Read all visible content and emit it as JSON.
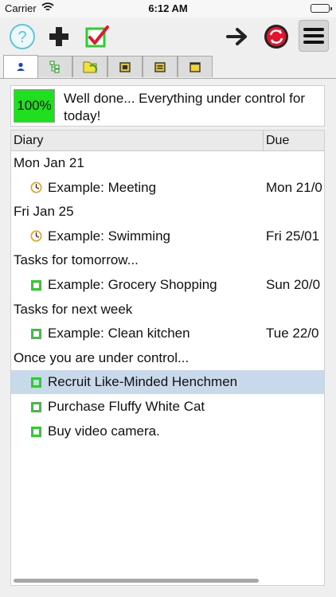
{
  "status_bar": {
    "carrier": "Carrier",
    "time": "6:12 AM"
  },
  "toolbar": {
    "help_icon": "question-circle-icon",
    "add_icon": "plus-icon",
    "complete_icon": "red-checkmark-icon",
    "forward_icon": "arrow-right-icon",
    "sync_icon": "red-sync-icon",
    "menu_icon": "hamburger-menu-icon"
  },
  "tabs": [
    {
      "icon": "person-icon",
      "active": true
    },
    {
      "icon": "hierarchy-icon",
      "active": false
    },
    {
      "icon": "folder-icon",
      "active": false
    },
    {
      "icon": "calendar-icon",
      "active": false
    },
    {
      "icon": "calendar-icon",
      "active": false
    },
    {
      "icon": "notepad-icon",
      "active": false
    }
  ],
  "banner": {
    "percent": "100%",
    "message": "Well done... Everything under control for today!",
    "percent_color": "#1fe01f"
  },
  "table": {
    "headers": {
      "diary": "Diary",
      "due": "Due"
    },
    "rows": [
      {
        "type": "group",
        "label": "Mon Jan 21"
      },
      {
        "type": "task",
        "icon": "clock-icon",
        "label": "Example: Meeting",
        "due": "Mon 21/0"
      },
      {
        "type": "group",
        "label": "Fri Jan 25"
      },
      {
        "type": "task",
        "icon": "clock-icon",
        "label": "Example: Swimming",
        "due": "Fri 25/01"
      },
      {
        "type": "group",
        "label": "Tasks for tomorrow..."
      },
      {
        "type": "task",
        "icon": "checkbox-icon",
        "label": "Example: Grocery Shopping",
        "due": "Sun 20/0"
      },
      {
        "type": "group",
        "label": "Tasks  for next week"
      },
      {
        "type": "task",
        "icon": "checkbox-icon",
        "label": "Example: Clean kitchen",
        "due": "Tue 22/0"
      },
      {
        "type": "group",
        "label": "Once you are under control..."
      },
      {
        "type": "task",
        "icon": "checkbox-icon",
        "label": "Recruit Like-Minded Henchmen",
        "due": "",
        "selected": true
      },
      {
        "type": "task",
        "icon": "checkbox-icon",
        "label": "Purchase Fluffy White Cat",
        "due": ""
      },
      {
        "type": "task",
        "icon": "checkbox-icon",
        "label": "Buy video camera.",
        "due": ""
      }
    ]
  },
  "colors": {
    "selected_row": "#c9d9ec",
    "checkbox": "#2ecc2e",
    "clock": "#e8a317"
  }
}
